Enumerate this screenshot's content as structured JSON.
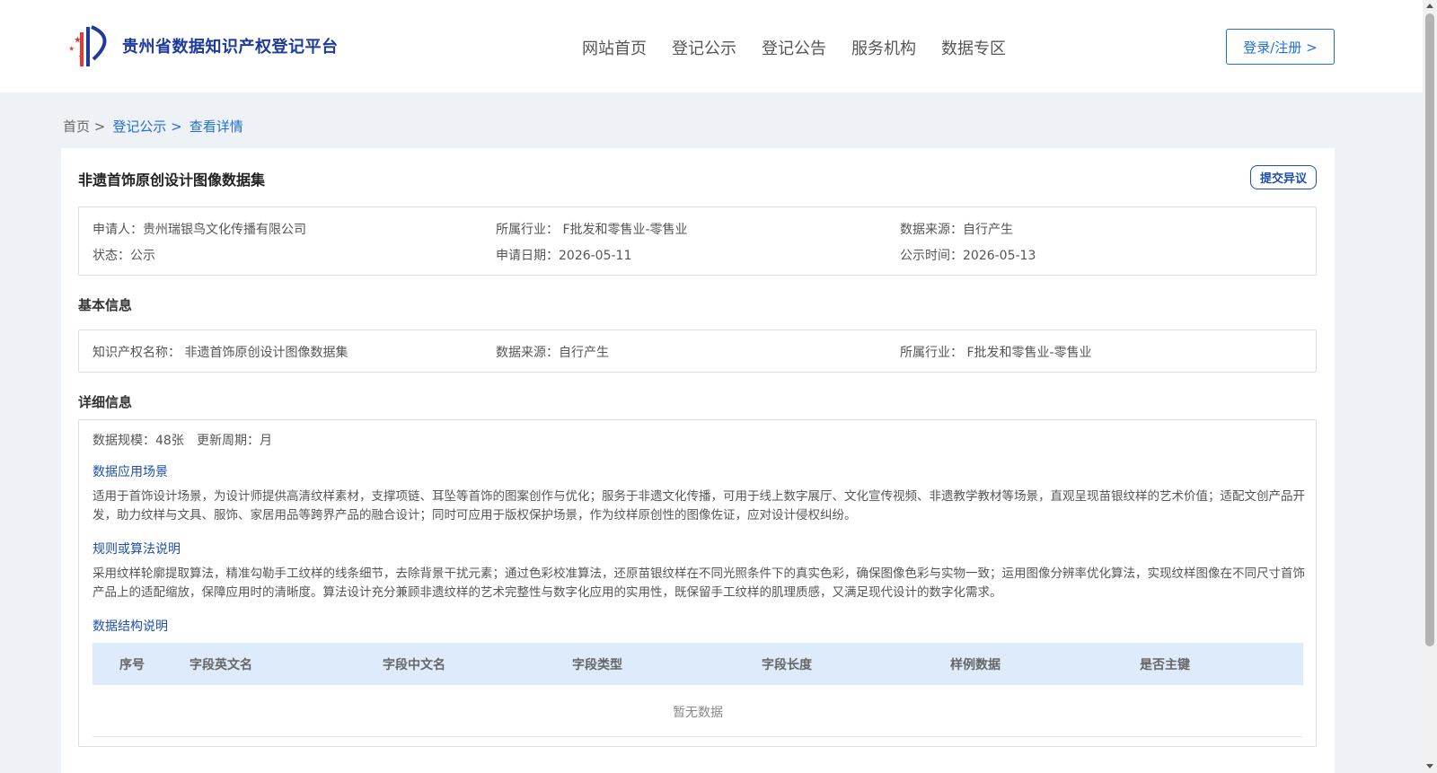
{
  "header": {
    "logo_text": "贵州省数据知识产权登记平台",
    "nav": [
      "网站首页",
      "登记公示",
      "登记公告",
      "服务机构",
      "数据专区"
    ],
    "login_label": "登录/注册 >"
  },
  "breadcrumb": {
    "home": "首页 >",
    "items": [
      "登记公示 >",
      "查看详情"
    ]
  },
  "record": {
    "title": "非遗首饰原创设计图像数据集",
    "objection_label": "提交异议",
    "applicant": "申请人：贵州瑞银鸟文化传播有限公司",
    "industry": "所属行业： F批发和零售业-零售业",
    "source": "数据来源：自行产生",
    "status": "状态：公示",
    "apply_date": "申请日期：2026-05-11",
    "public_date": "公示时间：2026-05-13"
  },
  "basic": {
    "title": "基本信息",
    "ip_name": "知识产权名称： 非遗首饰原创设计图像数据集",
    "source": "数据来源：自行产生",
    "industry": "所属行业： F批发和零售业-零售业"
  },
  "detail": {
    "title": "详细信息",
    "scale": "数据规模：48张",
    "cycle": "更新周期：月",
    "scene_title": "数据应用场景",
    "scene_text": "适用于首饰设计场景，为设计师提供高清纹样素材，支撑项链、耳坠等首饰的图案创作与优化；服务于非遗文化传播，可用于线上数字展厅、文化宣传视频、非遗教学教材等场景，直观呈现苗银纹样的艺术价值；适配文创产品开发，助力纹样与文具、服饰、家居用品等跨界产品的融合设计；同时可应用于版权保护场景，作为纹样原创性的图像佐证，应对设计侵权纠纷。",
    "algo_title": "规则或算法说明",
    "algo_text": "采用纹样轮廓提取算法，精准勾勒手工纹样的线条细节，去除背景干扰元素；通过色彩校准算法，还原苗银纹样在不同光照条件下的真实色彩，确保图像色彩与实物一致；运用图像分辨率优化算法，实现纹样图像在不同尺寸首饰产品上的适配缩放，保障应用时的清晰度。算法设计充分兼顾非遗纹样的艺术完整性与数字化应用的实用性，既保留手工纹样的肌理质感，又满足现代设计的数字化需求。",
    "struct_title": "数据结构说明",
    "columns": [
      "序号",
      "字段英文名",
      "字段中文名",
      "字段类型",
      "字段长度",
      "样例数据",
      "是否主键"
    ],
    "empty_text": "暂无数据"
  }
}
